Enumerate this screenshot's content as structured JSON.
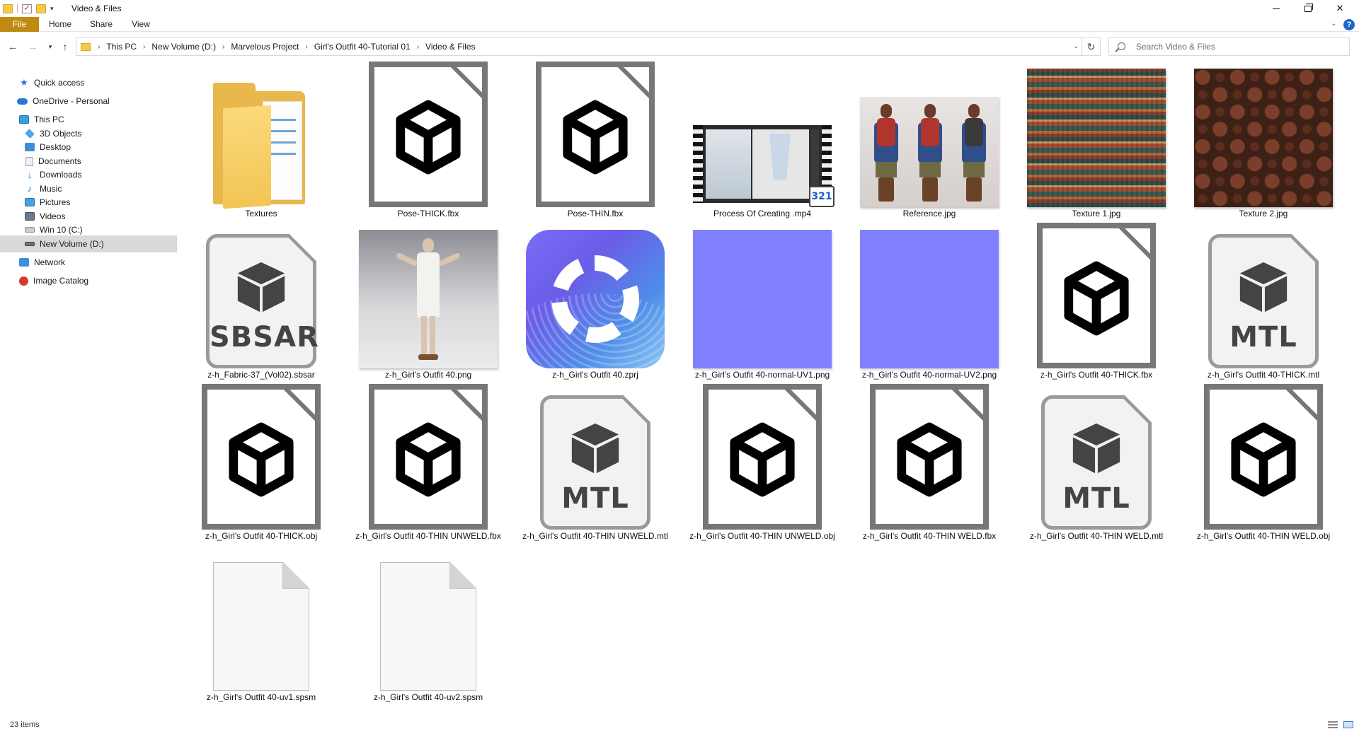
{
  "window": {
    "title": "Video & Files"
  },
  "ribbon": {
    "tabs": [
      "File",
      "Home",
      "Share",
      "View"
    ]
  },
  "address": {
    "breadcrumbs": [
      "This PC",
      "New Volume (D:)",
      "Marvelous Project",
      "Girl's Outfit 40-Tutorial 01",
      "Video & Files"
    ]
  },
  "search": {
    "placeholder": "Search Video & Files"
  },
  "nav": {
    "items": [
      {
        "label": "Quick access",
        "icon": "star-icon"
      },
      {
        "label": "OneDrive - Personal",
        "icon": "cloud-icon"
      },
      {
        "label": "This PC",
        "icon": "computer-icon"
      },
      {
        "label": "3D Objects",
        "icon": "3d-objects-icon"
      },
      {
        "label": "Desktop",
        "icon": "desktop-icon"
      },
      {
        "label": "Documents",
        "icon": "documents-icon"
      },
      {
        "label": "Downloads",
        "icon": "downloads-icon"
      },
      {
        "label": "Music",
        "icon": "music-icon"
      },
      {
        "label": "Pictures",
        "icon": "pictures-icon"
      },
      {
        "label": "Videos",
        "icon": "videos-icon"
      },
      {
        "label": "Win 10 (C:)",
        "icon": "drive-icon"
      },
      {
        "label": "New Volume (D:)",
        "icon": "drive-icon",
        "selected": true
      },
      {
        "label": "Network",
        "icon": "network-icon"
      },
      {
        "label": "Image Catalog",
        "icon": "image-catalog-icon"
      }
    ]
  },
  "files": [
    {
      "name": "Textures",
      "kind": "folder"
    },
    {
      "name": "Pose-THICK.fbx",
      "kind": "3d-model"
    },
    {
      "name": "Pose-THIN.fbx",
      "kind": "3d-model"
    },
    {
      "name": "Process Of Creating .mp4",
      "kind": "video",
      "badge": "321"
    },
    {
      "name": "Reference.jpg",
      "kind": "image"
    },
    {
      "name": "Texture 1.jpg",
      "kind": "image"
    },
    {
      "name": "Texture 2.jpg",
      "kind": "image"
    },
    {
      "name": "z-h_Fabric-37_(Vol02).sbsar",
      "kind": "substance",
      "badge": "SBSAR"
    },
    {
      "name": "z-h_Girl's Outfit 40.png",
      "kind": "image"
    },
    {
      "name": "z-h_Girl's Outfit 40.zprj",
      "kind": "project"
    },
    {
      "name": "z-h_Girl's Outfit 40-normal-UV1.png",
      "kind": "image"
    },
    {
      "name": "z-h_Girl's Outfit 40-normal-UV2.png",
      "kind": "image"
    },
    {
      "name": "z-h_Girl's Outfit 40-THICK.fbx",
      "kind": "3d-model"
    },
    {
      "name": "z-h_Girl's Outfit 40-THICK.mtl",
      "kind": "material",
      "badge": "MTL"
    },
    {
      "name": "z-h_Girl's Outfit 40-THICK.obj",
      "kind": "3d-model"
    },
    {
      "name": "z-h_Girl's Outfit 40-THIN UNWELD.fbx",
      "kind": "3d-model"
    },
    {
      "name": "z-h_Girl's Outfit 40-THIN UNWELD.mtl",
      "kind": "material",
      "badge": "MTL"
    },
    {
      "name": "z-h_Girl's Outfit 40-THIN UNWELD.obj",
      "kind": "3d-model"
    },
    {
      "name": "z-h_Girl's Outfit 40-THIN WELD.fbx",
      "kind": "3d-model"
    },
    {
      "name": "z-h_Girl's Outfit 40-THIN WELD.mtl",
      "kind": "material",
      "badge": "MTL"
    },
    {
      "name": "z-h_Girl's Outfit 40-THIN WELD.obj",
      "kind": "3d-model"
    },
    {
      "name": "z-h_Girl's Outfit 40-uv1.spsm",
      "kind": "blank"
    },
    {
      "name": "z-h_Girl's Outfit 40-uv2.spsm",
      "kind": "blank"
    }
  ],
  "status": {
    "item_count": "23 items"
  },
  "colors": {
    "file_tab": "#c08a12",
    "selected_nav": "#d9d9d9",
    "accent": "#2a78d6",
    "normal_map": "#8080ff"
  }
}
